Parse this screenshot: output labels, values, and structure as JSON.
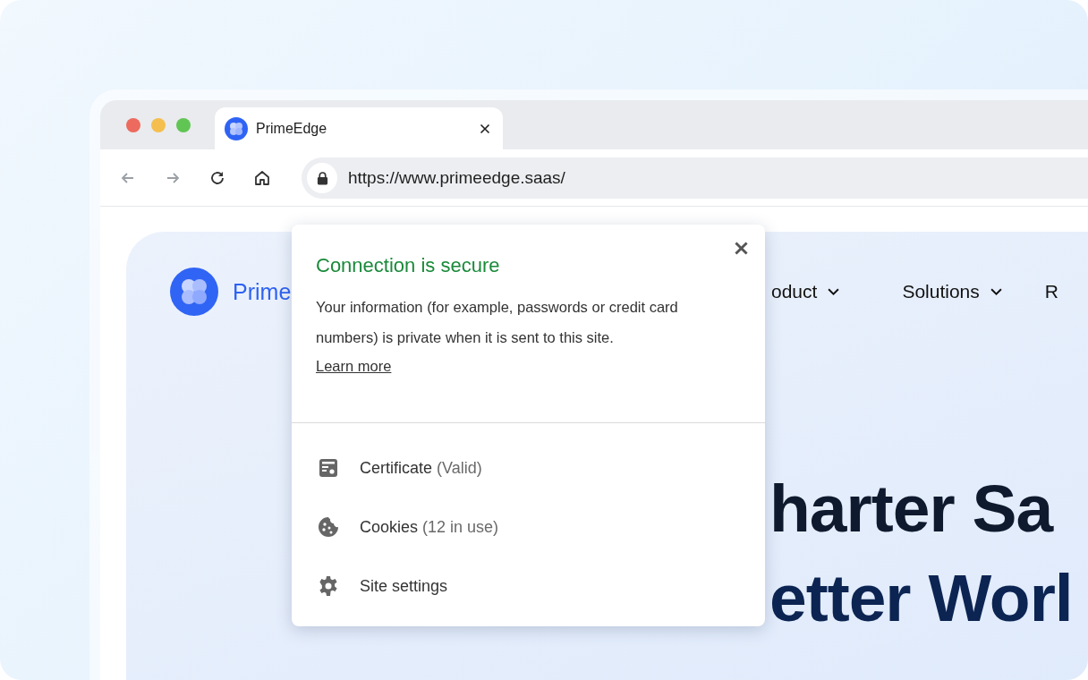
{
  "browser": {
    "tab": {
      "title": "PrimeEdge"
    },
    "address": "https://www.primeedge.saas/"
  },
  "page": {
    "brand": "Prime",
    "nav": [
      {
        "label": "oduct",
        "caret": true
      },
      {
        "label": "Solutions",
        "caret": true
      },
      {
        "label": "R",
        "caret": false
      }
    ],
    "hero_lines": [
      "harter Sa",
      "etter Worl"
    ]
  },
  "popup": {
    "title": "Connection is secure",
    "description": "Your information (for example, passwords or credit card numbers) is private when it is sent to this site.",
    "link": "Learn more",
    "items": [
      {
        "kind": "certificate",
        "label": "Certificate",
        "detail": "(Valid)"
      },
      {
        "kind": "cookies",
        "label": "Cookies",
        "detail": "(12 in use)"
      },
      {
        "kind": "settings",
        "label": "Site settings"
      }
    ]
  }
}
